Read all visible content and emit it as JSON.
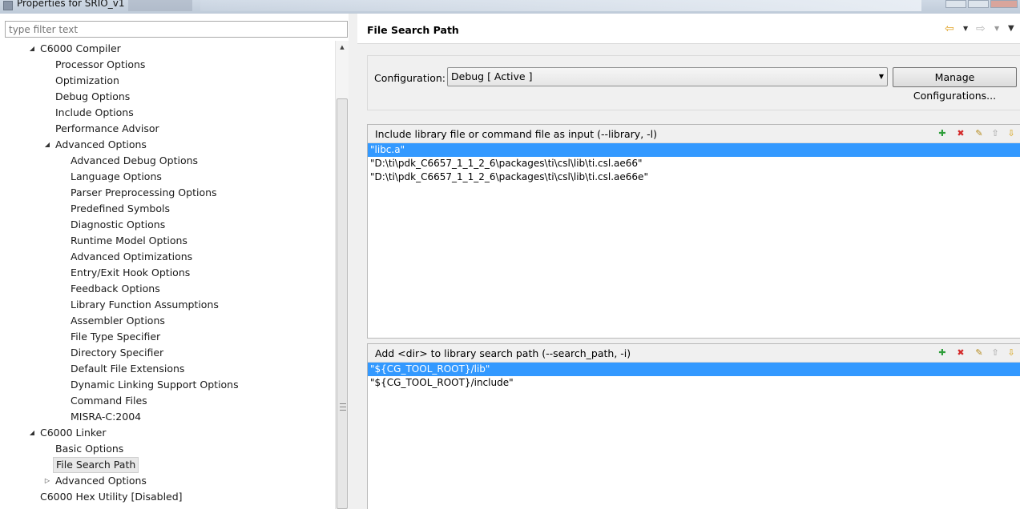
{
  "window": {
    "title": "Properties for SRIO_v1"
  },
  "filter": {
    "placeholder": "type filter text"
  },
  "tree": {
    "items": [
      {
        "label": "C6000 Compiler",
        "level": 0,
        "toggle": "expanded"
      },
      {
        "label": "Processor Options",
        "level": 1
      },
      {
        "label": "Optimization",
        "level": 1
      },
      {
        "label": "Debug Options",
        "level": 1
      },
      {
        "label": "Include Options",
        "level": 1
      },
      {
        "label": "Performance Advisor",
        "level": 1
      },
      {
        "label": "Advanced Options",
        "level": 1,
        "toggle": "expanded"
      },
      {
        "label": "Advanced Debug Options",
        "level": 2
      },
      {
        "label": "Language Options",
        "level": 2
      },
      {
        "label": "Parser Preprocessing Options",
        "level": 2
      },
      {
        "label": "Predefined Symbols",
        "level": 2
      },
      {
        "label": "Diagnostic Options",
        "level": 2
      },
      {
        "label": "Runtime Model Options",
        "level": 2
      },
      {
        "label": "Advanced Optimizations",
        "level": 2
      },
      {
        "label": "Entry/Exit Hook Options",
        "level": 2
      },
      {
        "label": "Feedback Options",
        "level": 2
      },
      {
        "label": "Library Function Assumptions",
        "level": 2
      },
      {
        "label": "Assembler Options",
        "level": 2
      },
      {
        "label": "File Type Specifier",
        "level": 2
      },
      {
        "label": "Directory Specifier",
        "level": 2
      },
      {
        "label": "Default File Extensions",
        "level": 2
      },
      {
        "label": "Dynamic Linking Support Options",
        "level": 2
      },
      {
        "label": "Command Files",
        "level": 2
      },
      {
        "label": "MISRA-C:2004",
        "level": 2
      },
      {
        "label": "C6000 Linker",
        "level": 0,
        "toggle": "expanded"
      },
      {
        "label": "Basic Options",
        "level": 1
      },
      {
        "label": "File Search Path",
        "level": 1,
        "selected": true
      },
      {
        "label": "Advanced Options",
        "level": 1,
        "toggle": "collapsed"
      },
      {
        "label": "C6000 Hex Utility  [Disabled]",
        "level": 0
      }
    ]
  },
  "page": {
    "title": "File Search Path",
    "nav_back_icon": "back-arrow-icon",
    "nav_forward_icon": "forward-arrow-icon",
    "menu_icon": "view-menu-icon"
  },
  "configuration": {
    "label": "Configuration:",
    "value": "Debug  [ Active ]",
    "manage_label": "Manage Configurations..."
  },
  "library_list": {
    "label": "Include library file or command file as input (--library, -l)",
    "items": [
      "\"libc.a\"",
      "\"D:\\ti\\pdk_C6657_1_1_2_6\\packages\\ti\\csl\\lib\\ti.csl.ae66\"",
      "\"D:\\ti\\pdk_C6657_1_1_2_6\\packages\\ti\\csl\\lib\\ti.csl.ae66e\""
    ],
    "selected_index": 0
  },
  "search_path_list": {
    "label": "Add <dir> to library search path (--search_path, -i)",
    "items": [
      "\"${CG_TOOL_ROOT}/lib\"",
      "\"${CG_TOOL_ROOT}/include\""
    ],
    "selected_index": 0
  },
  "toolbar_icons": [
    "add-icon",
    "delete-icon",
    "edit-icon",
    "move-up-icon",
    "move-down-icon"
  ],
  "colors": {
    "selection": "#3399ff",
    "tree_selected_bg": "#e8e8e8",
    "add_icon": "#2e9e3a",
    "delete_icon": "#d42a2a"
  }
}
